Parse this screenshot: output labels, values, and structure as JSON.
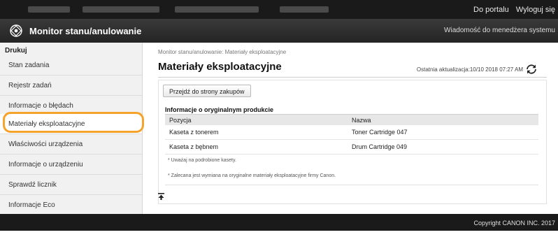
{
  "topbar": {
    "portal_link": "Do portalu",
    "logout_link": "Wyloguj się"
  },
  "header": {
    "app_title": "Monitor stanu/anulowanie",
    "admin_message": "Wiadomość do menedżera systemu"
  },
  "sidebar": {
    "group_label": "Drukuj",
    "items": [
      {
        "label": "Stan zadania"
      },
      {
        "label": "Rejestr zadań"
      },
      {
        "label": "Informacje o błędach"
      },
      {
        "label": "Materiały eksploatacyjne"
      },
      {
        "label": "Właściwości urządzenia"
      },
      {
        "label": "Informacje o urządzeniu"
      },
      {
        "label": "Sprawdź licznik"
      },
      {
        "label": "Informacje Eco"
      }
    ],
    "highlight_color": "#f5a32a"
  },
  "main": {
    "breadcrumb": "Monitor stanu/anulowanie: Materiały eksploatacyjne",
    "title": "Materiały eksploatacyjne",
    "last_update": "Ostatnia aktualizacja:10/10 2018 07:27 AM",
    "shop_button": "Przejdź do strony zakupów",
    "section_title": "Informacje o oryginalnym produkcie",
    "table": {
      "headers": [
        "Pozycja",
        "Nazwa"
      ],
      "rows": [
        [
          "Kaseta z tonerem",
          "Toner Cartridge 047"
        ],
        [
          "Kaseta z bębnem",
          "Drum Cartridge 049"
        ]
      ]
    },
    "notes": [
      "* Uważaj na podrobione kasety.",
      "* Zalecana jest wymiana na oryginalne materiały eksploatacyjne firmy Canon."
    ]
  },
  "footer": {
    "copyright": "Copyright CANON INC. 2017"
  },
  "icons": {
    "logo": "monitor-logo-icon",
    "refresh": "refresh-icon",
    "to_top": "back-to-top-icon"
  }
}
